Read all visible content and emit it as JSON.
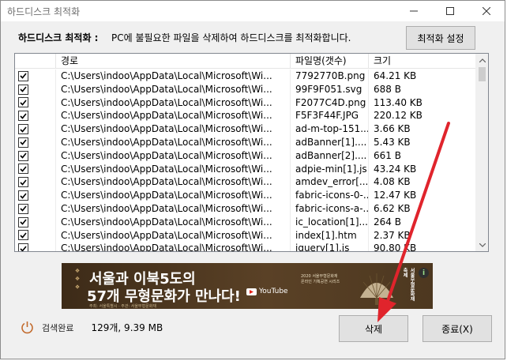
{
  "window": {
    "title": "하드디스크 최적화"
  },
  "toprow": {
    "label": "하드디스크 최적화 :",
    "desc": "PC에 불필요한 파일을 삭제하여 하드디스크를 최적화합니다.",
    "settings_button": "최적화 설정"
  },
  "list": {
    "columns": [
      "",
      "경로",
      "파일명(갯수)",
      "크기"
    ],
    "rows": [
      {
        "checked": true,
        "path": "C:\\Users\\indoo\\AppData\\Local\\Microsoft\\Wi...",
        "name": "7792770B.png",
        "size": "64.21 KB"
      },
      {
        "checked": true,
        "path": "C:\\Users\\indoo\\AppData\\Local\\Microsoft\\Wi...",
        "name": "99F9F051.svg",
        "size": "688 B"
      },
      {
        "checked": true,
        "path": "C:\\Users\\indoo\\AppData\\Local\\Microsoft\\Wi...",
        "name": "F2077C4D.png",
        "size": "113.40 KB"
      },
      {
        "checked": true,
        "path": "C:\\Users\\indoo\\AppData\\Local\\Microsoft\\Wi...",
        "name": "F5F3F44F.JPG",
        "size": "220.12 KB"
      },
      {
        "checked": true,
        "path": "C:\\Users\\indoo\\AppData\\Local\\Microsoft\\Wi...",
        "name": "ad-m-top-151...",
        "size": "3.66 KB"
      },
      {
        "checked": true,
        "path": "C:\\Users\\indoo\\AppData\\Local\\Microsoft\\Wi...",
        "name": "adBanner[1]....",
        "size": "5.43 KB"
      },
      {
        "checked": true,
        "path": "C:\\Users\\indoo\\AppData\\Local\\Microsoft\\Wi...",
        "name": "adBanner[2]....",
        "size": "661 B"
      },
      {
        "checked": true,
        "path": "C:\\Users\\indoo\\AppData\\Local\\Microsoft\\Wi...",
        "name": "adpie-min[1].js",
        "size": "43.24 KB"
      },
      {
        "checked": true,
        "path": "C:\\Users\\indoo\\AppData\\Local\\Microsoft\\Wi...",
        "name": "amdev_error[...",
        "size": "4.08 KB"
      },
      {
        "checked": true,
        "path": "C:\\Users\\indoo\\AppData\\Local\\Microsoft\\Wi...",
        "name": "fabric-icons-0-...",
        "size": "12.47 KB"
      },
      {
        "checked": true,
        "path": "C:\\Users\\indoo\\AppData\\Local\\Microsoft\\Wi...",
        "name": "fabric-icons-a-...",
        "size": "6.62 KB"
      },
      {
        "checked": true,
        "path": "C:\\Users\\indoo\\AppData\\Local\\Microsoft\\Wi...",
        "name": "ic_location[1]....",
        "size": "264 B"
      },
      {
        "checked": true,
        "path": "C:\\Users\\indoo\\AppData\\Local\\Microsoft\\Wi...",
        "name": "index[1].htm",
        "size": "2.37 KB"
      },
      {
        "checked": true,
        "path": "C:\\Users\\indoo\\AppData\\Local\\Microsoft\\Wi...",
        "name": "jquery[1].js",
        "size": "90.80 KB"
      }
    ]
  },
  "banner": {
    "line1": "서울과 이북5도의",
    "line2": "57개 무형문화가 만나다!",
    "youtube": "YouTube",
    "small": "주최: 서울특별시 · 주관: 서울무형문화재",
    "meta1": "2020 서울무형문화재",
    "meta2": "온라인 기획공연 시리즈",
    "vertical": "서울무형문화재 축제",
    "info": "i"
  },
  "status": {
    "icon": "power-icon",
    "label": "검색완료",
    "count": "129개, 9.39 MB"
  },
  "buttons": {
    "delete": "삭제",
    "exit": "종료(X)"
  },
  "colors": {
    "accent": "#e0242c",
    "banner": "#4a3520"
  }
}
